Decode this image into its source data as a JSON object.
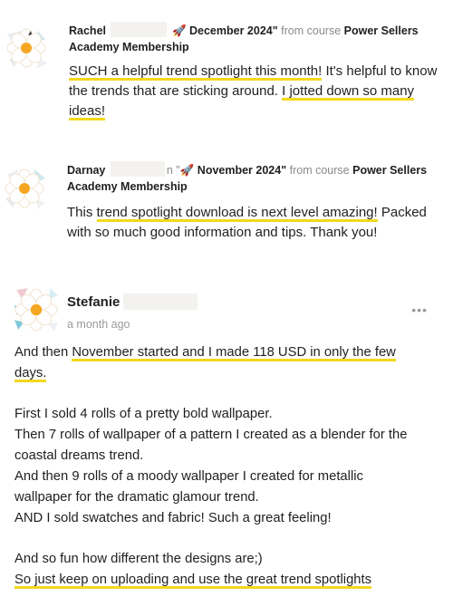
{
  "reviews": [
    {
      "name": "Rachel",
      "product_prefix": "",
      "product": "🚀 December 2024\"",
      "from_course": "from course",
      "course": "Power Sellers",
      "course_line2": "Academy Membership",
      "body_1": "SUCH a helpful trend spotlight this month!",
      "body_2": " It's helpful to know the trends that are sticking around. ",
      "body_3": "I jotted down so many",
      "body_4": "ideas!"
    },
    {
      "name": "Darnay",
      "product_prefix": "n \"",
      "product": "🚀 November 2024\"",
      "from_course": "from course",
      "course": "Power Sellers",
      "course_line2": "Academy Membership",
      "body_1": "This ",
      "body_2": "trend spotlight download is next level amazing!",
      "body_3": " Packed with so much good information and tips. Thank you!"
    }
  ],
  "comment": {
    "name": "Stefanie",
    "time": "a month ago",
    "more": "•••",
    "line1_pre": "And then ",
    "line1_hl": "November started and I made 118 USD in only the few",
    "line2_hl": "days.",
    "p2_l1": "First I sold 4 rolls of a pretty bold wallpaper.",
    "p2_l2": "Then 7 rolls of wallpaper of a pattern I created as a blender for the",
    "p2_l3": "coastal dreams trend.",
    "p2_l4": "And then 9 rolls of a moody wallpaper I created for metallic",
    "p2_l5": "wallpaper for the dramatic glamour trend.",
    "p2_l6": "AND I sold swatches and fabric! Such a great feeling!",
    "p3_l1": "And so fun how different the designs are;)",
    "p3_l2": "So just keep on uploading and use the great trend spotlights"
  },
  "colors": {
    "highlight": "#f3d81b",
    "muted": "#8a8a8a",
    "petal": "#ffffff",
    "center": "#f5a623"
  },
  "icons": {
    "avatar": "flower-avatar-icon",
    "rocket": "rocket-icon",
    "more": "more-options-icon"
  }
}
